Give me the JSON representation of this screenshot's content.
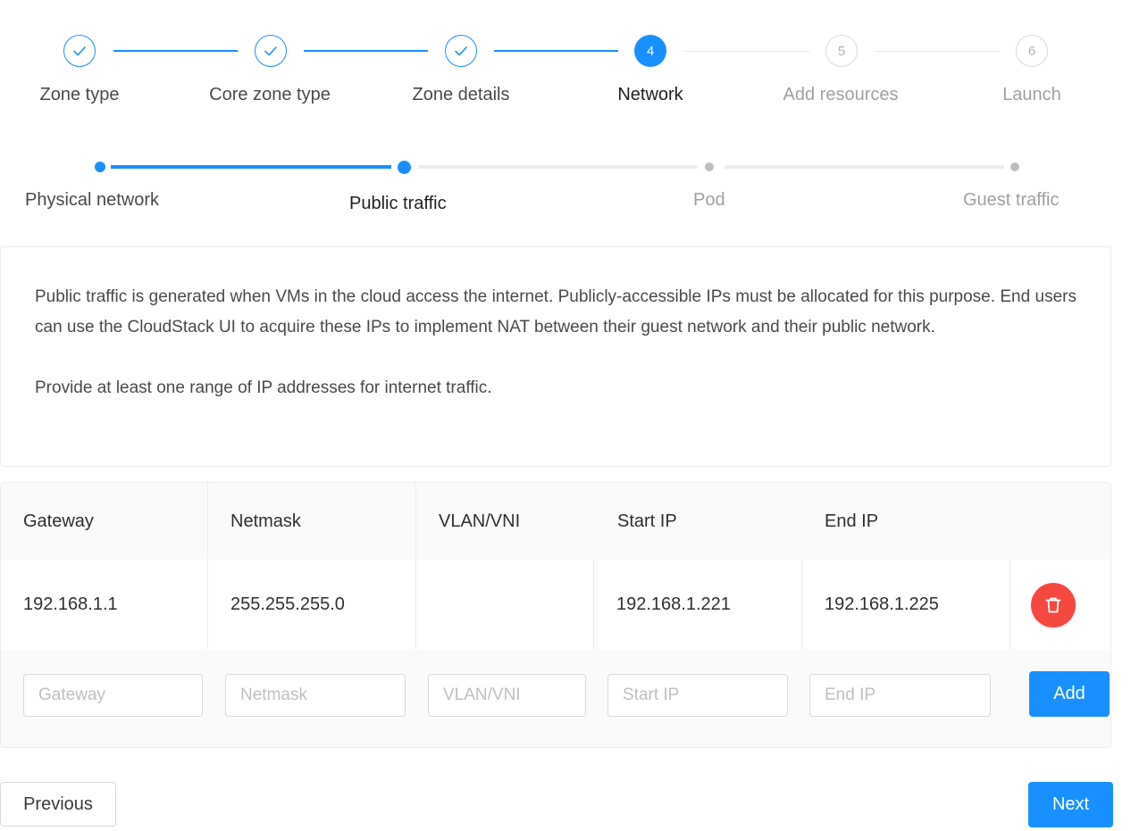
{
  "steps": [
    {
      "title": "Zone type",
      "status": "finish",
      "icon": "check-icon"
    },
    {
      "title": "Core zone type",
      "status": "finish",
      "icon": "check-icon"
    },
    {
      "title": "Zone details",
      "status": "finish",
      "icon": "check-icon"
    },
    {
      "title": "Network",
      "status": "process",
      "number": "4"
    },
    {
      "title": "Add resources",
      "status": "wait",
      "number": "5"
    },
    {
      "title": "Launch",
      "status": "wait",
      "number": "6"
    }
  ],
  "sub_steps": [
    {
      "title": "Physical network",
      "status": "finish"
    },
    {
      "title": "Public traffic",
      "status": "process"
    },
    {
      "title": "Pod",
      "status": "wait"
    },
    {
      "title": "Guest traffic",
      "status": "wait"
    }
  ],
  "description": {
    "paragraph1": "Public traffic is generated when VMs in the cloud access the internet. Publicly-accessible IPs must be allocated for this purpose. End users can use the CloudStack UI to acquire these IPs to implement NAT between their guest network and their public network.",
    "paragraph2": "Provide at least one range of IP addresses for internet traffic."
  },
  "table": {
    "columns": [
      "Gateway",
      "Netmask",
      "VLAN/VNI",
      "Start IP",
      "End IP"
    ],
    "rows": [
      {
        "gateway": "192.168.1.1",
        "netmask": "255.255.255.0",
        "vlan": "",
        "start_ip": "192.168.1.221",
        "end_ip": "192.168.1.225",
        "delete_icon": "trash-icon"
      }
    ]
  },
  "form": {
    "gateway_placeholder": "Gateway",
    "netmask_placeholder": "Netmask",
    "vlan_placeholder": "VLAN/VNI",
    "start_ip_placeholder": "Start IP",
    "end_ip_placeholder": "End IP",
    "add_label": "Add"
  },
  "footer": {
    "previous_label": "Previous",
    "next_label": "Next"
  },
  "colors": {
    "primary": "#1890ff",
    "danger": "#f5483f",
    "wait": "#bfbfbf"
  }
}
